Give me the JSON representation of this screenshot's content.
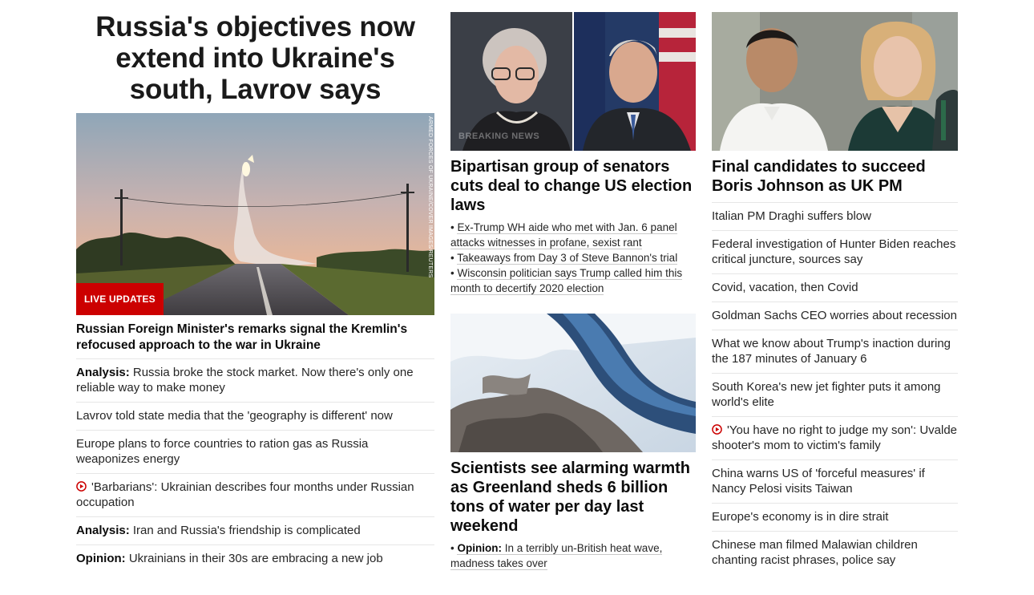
{
  "col1": {
    "headline": "Russia's objectives now extend into Ukraine's south, Lavrov says",
    "hero_credit": "ARMED FORCES OF UKRAINE/COVER IMAGES/REUTERS",
    "badge": "LIVE UPDATES",
    "subheadline": "Russian Foreign Minister's remarks signal the Kremlin's refocused approach to the war in Ukraine",
    "items": [
      {
        "kicker": "Analysis:",
        "text": "Russia broke the stock market. Now there's only one reliable way to make money"
      },
      {
        "kicker": "",
        "text": "Lavrov told state media that the 'geography is different' now"
      },
      {
        "kicker": "",
        "text": "Europe plans to force countries to ration gas as Russia weaponizes energy"
      },
      {
        "kicker": "",
        "text": "'Barbarians': Ukrainian describes four months under Russian occupation",
        "icon": "play-icon"
      },
      {
        "kicker": "Analysis:",
        "text": "Iran and Russia's friendship is complicated"
      },
      {
        "kicker": "Opinion:",
        "text": "Ukrainians in their 30s are embracing a new job"
      }
    ]
  },
  "col2": {
    "card1": {
      "overlay": "BREAKING NEWS",
      "title": "Bipartisan group of senators cuts deal to change US election laws",
      "bullets": [
        "Ex-Trump WH aide who met with Jan. 6 panel attacks witnesses in profane, sexist rant",
        "Takeaways from Day 3 of Steve Bannon's trial",
        "Wisconsin politician says Trump called him this month to decertify 2020 election"
      ]
    },
    "card2": {
      "title": "Scientists see alarming warmth as Greenland sheds 6 billion tons of water per day last weekend",
      "bullet_kicker": "Opinion:",
      "bullet_text": "In a terribly un-British heat wave, madness takes over"
    }
  },
  "col3": {
    "title": "Final candidates to succeed Boris Johnson as UK PM",
    "items": [
      {
        "text": "Italian PM Draghi suffers blow"
      },
      {
        "text": "Federal investigation of Hunter Biden reaches critical juncture, sources say"
      },
      {
        "text": "Covid, vacation, then Covid"
      },
      {
        "text": "Goldman Sachs CEO worries about recession"
      },
      {
        "text": "What we know about Trump's inaction during the 187 minutes of January 6"
      },
      {
        "text": "South Korea's new jet fighter puts it among world's elite"
      },
      {
        "text": "'You have no right to judge my son': Uvalde shooter's mom to victim's family",
        "icon": "play-icon"
      },
      {
        "text": "China warns US of 'forceful measures' if Nancy Pelosi visits Taiwan"
      },
      {
        "text": "Europe's economy is in dire strait"
      },
      {
        "text": "Chinese man filmed Malawian children chanting racist phrases, police say"
      }
    ]
  },
  "colors": {
    "badge_red": "#cc0000",
    "play_icon_red": "#cc0000"
  }
}
